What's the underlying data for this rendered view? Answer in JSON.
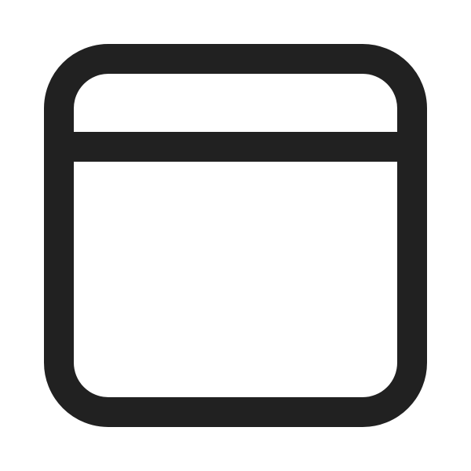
{
  "icon": {
    "name": "browser-window-icon",
    "stroke_color": "#212121",
    "background_color": "#ffffff"
  }
}
